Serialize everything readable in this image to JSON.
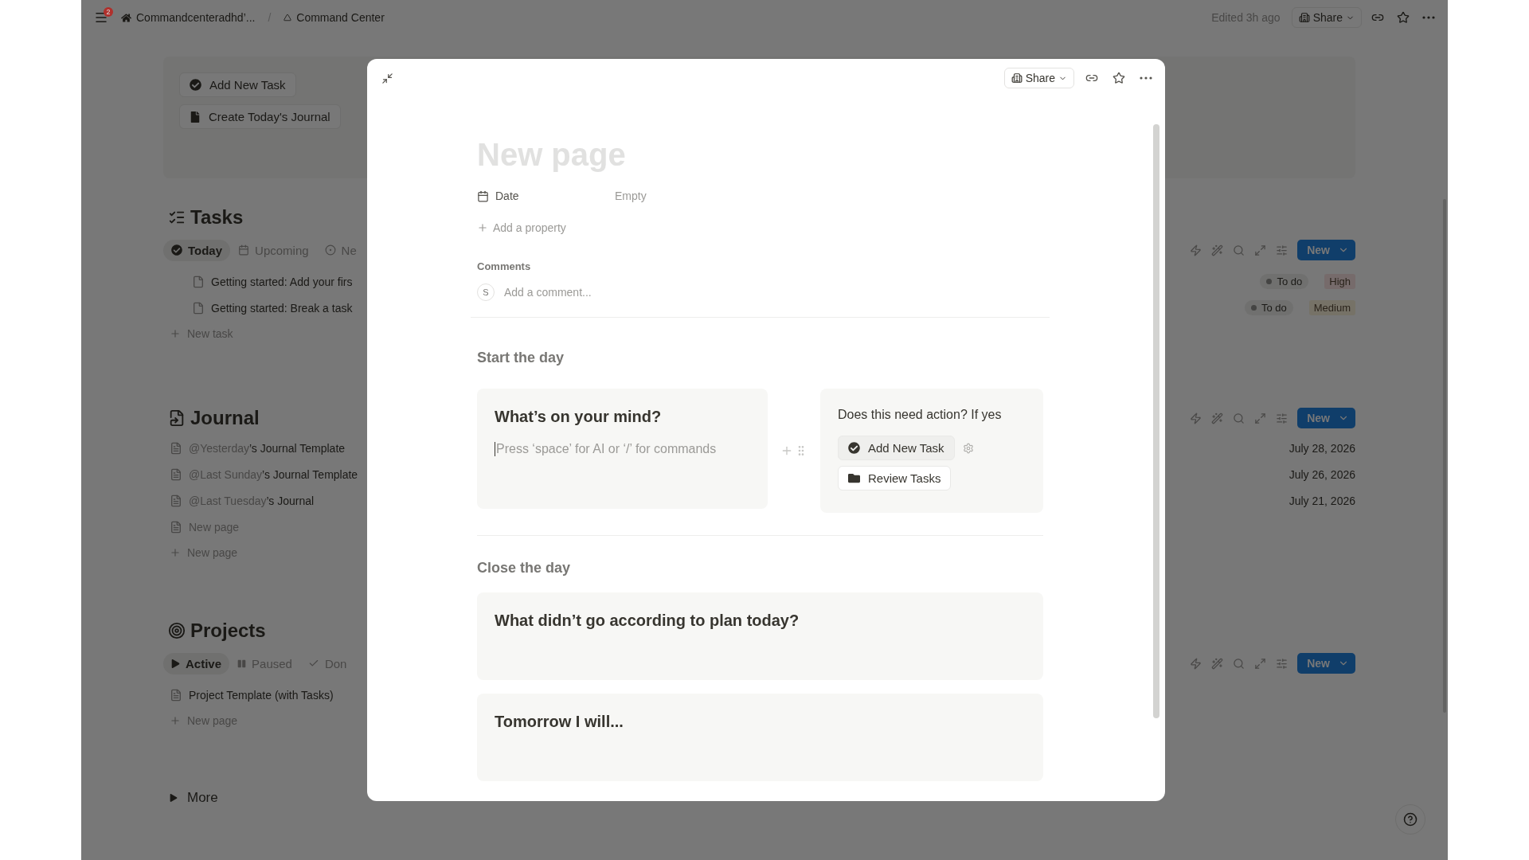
{
  "topbar": {
    "badge": "2",
    "breadcrumbs": [
      {
        "label": "Commandcenteradhd’..."
      },
      {
        "label": "Command Center"
      }
    ],
    "separator": "/",
    "edited": "Edited 3h ago",
    "share": "Share"
  },
  "actions": [
    {
      "label": "Add New Task"
    },
    {
      "label": "Create Today's Journal"
    }
  ],
  "sections": [
    {
      "title": "Tasks",
      "new_button": "New",
      "add_row": "New task",
      "tabs": [
        {
          "label": "Today",
          "selected": true
        },
        {
          "label": "Upcoming",
          "selected": false
        },
        {
          "label": "Ne",
          "selected": false
        }
      ],
      "rows": [
        {
          "kind": "page",
          "title": "Getting started: Add your firs",
          "status": "To do",
          "priority": {
            "label": "High",
            "color": "#766b6b"
          }
        },
        {
          "kind": "page",
          "title": "Getting started: Break a task",
          "status": "To do",
          "priority": {
            "label": "Medium",
            "color": "#767267"
          }
        }
      ]
    },
    {
      "title": "Journal",
      "new_button": "New",
      "add_row": "New page",
      "rows": [
        {
          "kind": "page",
          "mention": "@Yesterday",
          "title": "’s Journal Template",
          "date": "July 28, 2026"
        },
        {
          "kind": "page",
          "mention": "@Last Sunday",
          "title": "’s Journal Template",
          "date": "July 26, 2026"
        },
        {
          "kind": "page",
          "mention": "@Last Tuesday",
          "title": "’s Journal",
          "date": "July 21, 2026"
        },
        {
          "kind": "empty",
          "title": "New page"
        }
      ]
    },
    {
      "title": "Projects",
      "new_button": "New",
      "add_row": "New page",
      "tabs": [
        {
          "label": "Active",
          "selected": true
        },
        {
          "label": "Paused",
          "selected": false
        },
        {
          "label": "Don",
          "selected": false
        }
      ],
      "rows": [
        {
          "kind": "page",
          "title": "Project Template (with Tasks)"
        }
      ]
    }
  ],
  "more": "More",
  "modal": {
    "share": "Share",
    "title_placeholder": "New page",
    "properties": [
      {
        "name": "Date",
        "value": "Empty"
      }
    ],
    "add_property": "Add a property",
    "comments_label": "Comments",
    "avatar": "S",
    "comment_placeholder": "Add a comment...",
    "blocks": [
      {
        "kind": "heading",
        "text": "Start the day"
      },
      {
        "kind": "columns",
        "left": {
          "title": "What’s on your mind?",
          "placeholder": "Press ‘space’ for AI or ‘/’ for commands"
        },
        "right": {
          "text": "Does this need action? If yes",
          "buttons": [
            {
              "label": "Add New Task",
              "hovered": true
            },
            {
              "label": "Review Tasks",
              "hovered": false
            }
          ]
        }
      },
      {
        "kind": "divider"
      },
      {
        "kind": "heading",
        "text": "Close the day"
      },
      {
        "kind": "callout",
        "title": "What didn’t go according to plan today?"
      },
      {
        "kind": "callout",
        "title": "Tomorrow I will..."
      }
    ]
  }
}
